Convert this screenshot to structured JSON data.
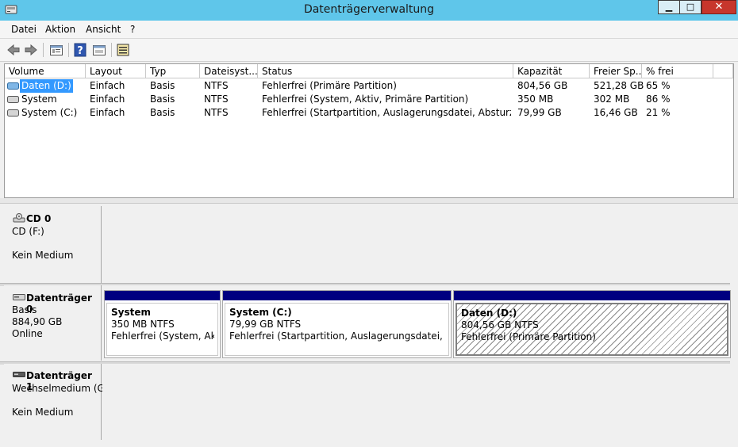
{
  "window": {
    "title": "Datenträgerverwaltung",
    "minimize": "▁",
    "maximize": "□",
    "close": "✕"
  },
  "menu": {
    "items": [
      "Datei",
      "Aktion",
      "Ansicht",
      "?"
    ]
  },
  "toolbar": {
    "icons": [
      "back-arrow-icon",
      "forward-arrow-icon",
      "properties-icon",
      "help-icon",
      "view-icon",
      "settings-icon"
    ]
  },
  "volume_list": {
    "columns": [
      "Volume",
      "Layout",
      "Typ",
      "Dateisyst...",
      "Status",
      "Kapazität",
      "Freier Sp...",
      "% frei"
    ],
    "rows": [
      {
        "volume": "Daten (D:)",
        "layout": "Einfach",
        "typ": "Basis",
        "fs": "NTFS",
        "status": "Fehlerfrei (Primäre Partition)",
        "capacity": "804,56 GB",
        "free": "521,28 GB",
        "pct": "65 %"
      },
      {
        "volume": "System",
        "layout": "Einfach",
        "typ": "Basis",
        "fs": "NTFS",
        "status": "Fehlerfrei (System, Aktiv, Primäre Partition)",
        "capacity": "350 MB",
        "free": "302 MB",
        "pct": "86 %"
      },
      {
        "volume": "System (C:)",
        "layout": "Einfach",
        "typ": "Basis",
        "fs": "NTFS",
        "status": "Fehlerfrei (Startpartition, Auslagerungsdatei, Absturzabbil...",
        "capacity": "79,99 GB",
        "free": "16,46 GB",
        "pct": "21 %"
      }
    ]
  },
  "disks": [
    {
      "name": "CD 0",
      "line1": "CD (F:)",
      "line2": "",
      "line3": "Kein Medium"
    },
    {
      "name": "Datenträger 0",
      "line1": "Basis",
      "line2": "884,90 GB",
      "line3": "Online",
      "partitions": [
        {
          "title": "System",
          "size": "350 MB NTFS",
          "status": "Fehlerfrei (System, Aktiv,"
        },
        {
          "title": "System  (C:)",
          "size": "79,99 GB NTFS",
          "status": "Fehlerfrei (Startpartition, Auslagerungsdatei, Absturz"
        },
        {
          "title": "Daten  (D:)",
          "size": "804,56 GB NTFS",
          "status": "Fehlerfrei (Primäre Partition)"
        }
      ]
    },
    {
      "name": "Datenträger 1",
      "line1": "Wechselmedium (G:",
      "line2": "",
      "line3": "Kein Medium"
    }
  ],
  "colors": {
    "titlebar": "#5fc6ea",
    "partition_band": "#000080",
    "selection": "#3399ff",
    "close_button": "#c7362c"
  }
}
